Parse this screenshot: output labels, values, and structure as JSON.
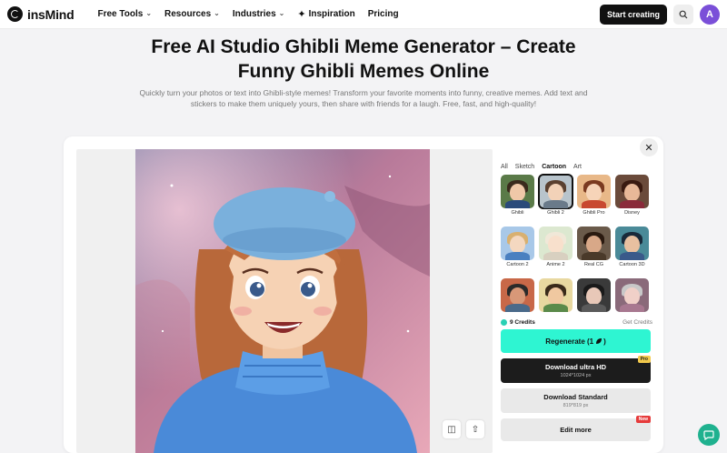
{
  "nav": {
    "logo_text": "insMind",
    "items": [
      {
        "label": "Free Tools"
      },
      {
        "label": "Resources"
      },
      {
        "label": "Industries"
      },
      {
        "label": "Inspiration"
      },
      {
        "label": "Pricing"
      }
    ],
    "start_label": "Start creating",
    "avatar_initial": "A"
  },
  "hero": {
    "title_line1": "Free AI Studio Ghibli Meme Generator – Create",
    "title_line2": "Funny Ghibli Memes Online",
    "subtitle_line1": "Quickly turn your photos or text into Ghibli-style memes! Transform your favorite moments into funny, creative memes. Add text and",
    "subtitle_line2": "stickers to make them uniquely yours, then share with friends for a laugh. Free, fast, and high-quality!"
  },
  "panel": {
    "tabs": [
      "All",
      "Sketch",
      "Cartoon",
      "Art"
    ],
    "active_tab": "Cartoon",
    "styles": [
      {
        "label": "Ghibli",
        "bg": "#5a7a48",
        "hair": "#3a2a1c",
        "skin": "#f0c8a8",
        "cloth": "#2a4a7a"
      },
      {
        "label": "Ghibli 2",
        "bg": "#b8c4cc",
        "hair": "#5a4030",
        "skin": "#f2d2b8",
        "cloth": "#6a7a8a",
        "selected": true
      },
      {
        "label": "Ghibli Pro",
        "bg": "#e8b888",
        "hair": "#7a3a20",
        "skin": "#f6d4b8",
        "cloth": "#c84830"
      },
      {
        "label": "Disney",
        "bg": "#6a4a3a",
        "hair": "#3a1a10",
        "skin": "#e8b898",
        "cloth": "#8a2a3a"
      },
      {
        "label": "Cartoon 2",
        "bg": "#a8c8e8",
        "hair": "#d8b070",
        "skin": "#f4d8c0",
        "cloth": "#4a80c0"
      },
      {
        "label": "Anime 2",
        "bg": "#dce8d0",
        "hair": "#f0e8d8",
        "skin": "#f8e0cc",
        "cloth": "#d8d0c0"
      },
      {
        "label": "Real CG",
        "bg": "#6a5a4a",
        "hair": "#2a1a10",
        "skin": "#d8a888",
        "cloth": "#4a3a2a"
      },
      {
        "label": "Cartoon 3D",
        "bg": "#4a8a98",
        "hair": "#1a2a3a",
        "skin": "#e8c0a0",
        "cloth": "#3a5a8a"
      },
      {
        "label": "",
        "bg": "#c86848",
        "hair": "#2a2a2a",
        "skin": "#d89878",
        "cloth": "#4a6a8a"
      },
      {
        "label": "",
        "bg": "#e8d8a0",
        "hair": "#3a2a1a",
        "skin": "#f0c8a0",
        "cloth": "#5a8a4a"
      },
      {
        "label": "",
        "bg": "#3a3a3a",
        "hair": "#1a1a1a",
        "skin": "#e8c8b8",
        "cloth": "#5a5a5a"
      },
      {
        "label": "",
        "bg": "#8a6a7a",
        "hair": "#c8c8c8",
        "skin": "#f0d0c8",
        "cloth": "#a87890"
      }
    ],
    "credits": "9 Credits",
    "get_credits": "Get Credits",
    "regenerate": "Regenerate (1",
    "download_hd": {
      "title": "Download ultra HD",
      "size": "1024*1024 px",
      "badge": "Pro"
    },
    "download_std": {
      "title": "Download Standard",
      "size": "819*819 px"
    },
    "edit_more": {
      "title": "Edit more",
      "badge": "New"
    }
  },
  "colors": {
    "accent": "#2ef5d2",
    "dark_button": "#1c1c1c",
    "avatar": "#7a4fd8",
    "chat": "#1fb18f"
  }
}
